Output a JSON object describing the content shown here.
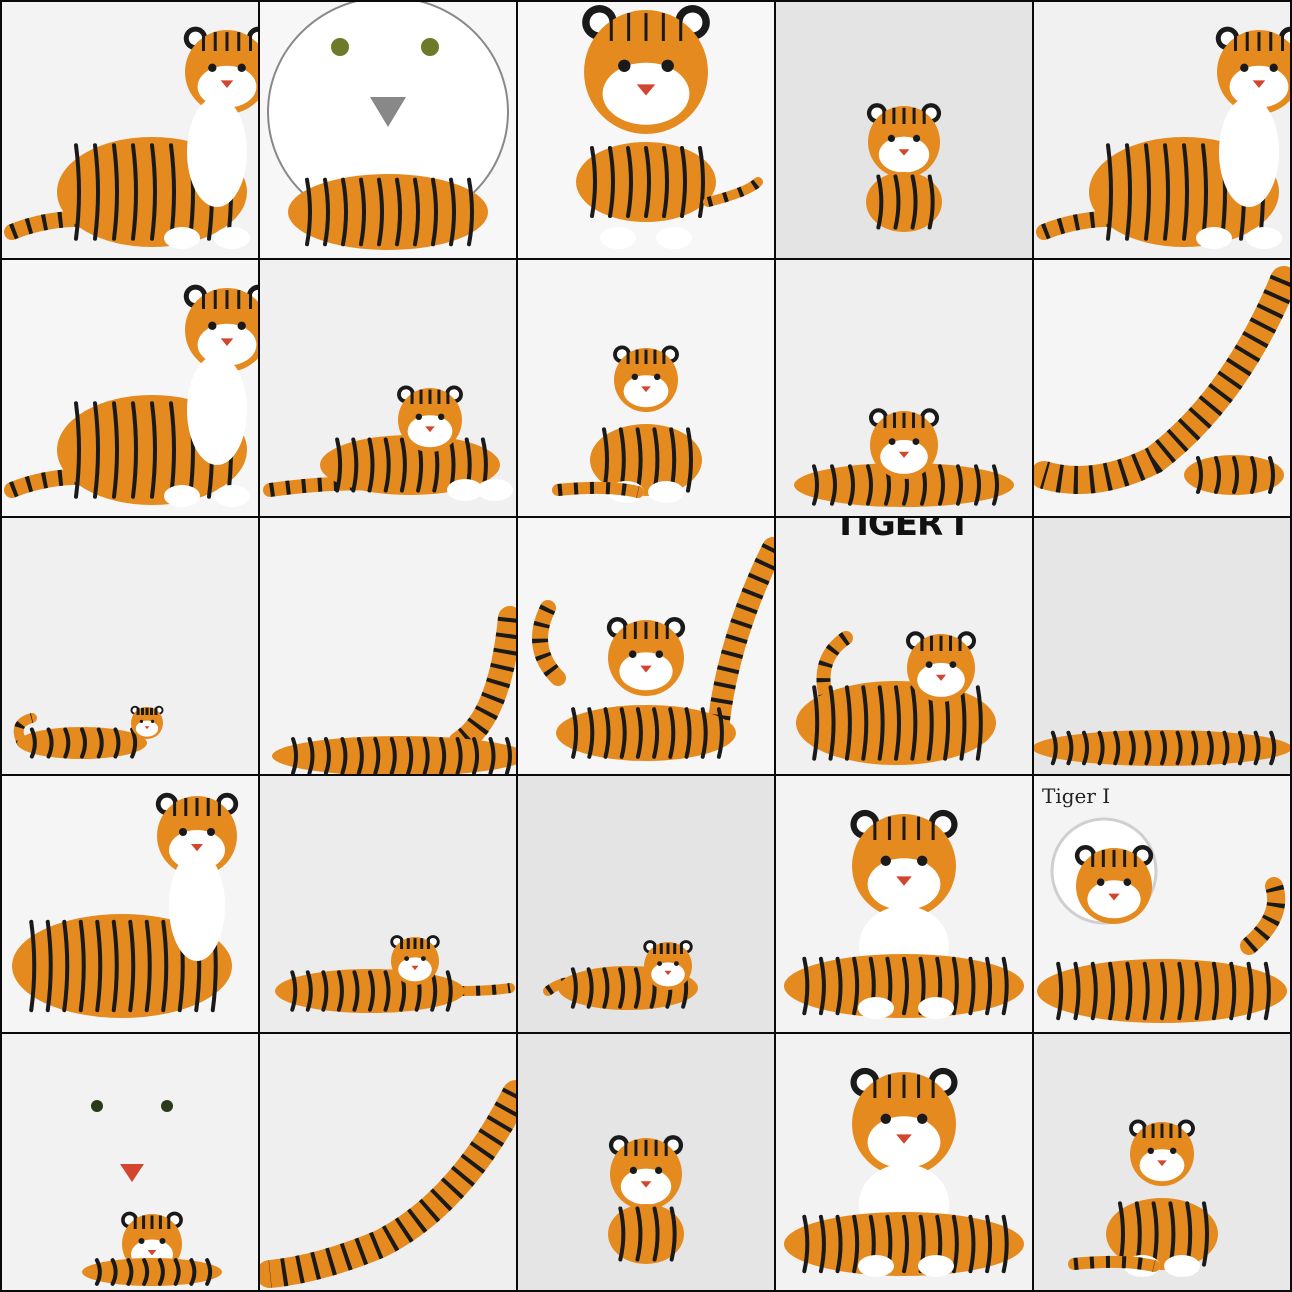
{
  "tiles": [
    {
      "id": "r1c1",
      "pose": "sit-right",
      "bg": "#f3f3f3",
      "caption": ""
    },
    {
      "id": "r1c2",
      "pose": "closeup-white",
      "bg": "#f7f7f7",
      "caption": ""
    },
    {
      "id": "r1c3",
      "pose": "face-front",
      "bg": "#f7f7f7",
      "caption": ""
    },
    {
      "id": "r1c4",
      "pose": "small-sit",
      "bg": "#e4e4e4",
      "caption": ""
    },
    {
      "id": "r1c5",
      "pose": "sit-right",
      "bg": "#f1f1f1",
      "caption": ""
    },
    {
      "id": "r2c1",
      "pose": "sit-right",
      "bg": "#f6f6f6",
      "caption": ""
    },
    {
      "id": "r2c2",
      "pose": "lie",
      "bg": "#f0f0f0",
      "caption": ""
    },
    {
      "id": "r2c3",
      "pose": "sit-front",
      "bg": "#f5f5f5",
      "caption": ""
    },
    {
      "id": "r2c4",
      "pose": "lie-center",
      "bg": "#efefef",
      "caption": ""
    },
    {
      "id": "r2c5",
      "pose": "tail-only",
      "bg": "#f5f5f5",
      "caption": ""
    },
    {
      "id": "r3c1",
      "pose": "small-lie",
      "bg": "#f0f0f0",
      "caption": ""
    },
    {
      "id": "r3c2",
      "pose": "tail-big",
      "bg": "#f3f3f3",
      "caption": ""
    },
    {
      "id": "r3c3",
      "pose": "arch",
      "bg": "#f6f6f6",
      "caption": ""
    },
    {
      "id": "r3c4",
      "pose": "crouch",
      "bg": "#f0f0f0",
      "caption": ""
    },
    {
      "id": "r3c5",
      "pose": "body-strip",
      "bg": "#e6e6e6",
      "caption": ""
    },
    {
      "id": "r4c1",
      "pose": "sit-tall",
      "bg": "#f5f5f5",
      "caption": ""
    },
    {
      "id": "r4c2",
      "pose": "lie-low",
      "bg": "#ececec",
      "caption": ""
    },
    {
      "id": "r4c3",
      "pose": "small-lie2",
      "bg": "#e4e4e4",
      "caption": ""
    },
    {
      "id": "r4c4",
      "pose": "big-sit",
      "bg": "#f3f3f3",
      "caption": ""
    },
    {
      "id": "r4c5",
      "pose": "face-side",
      "bg": "#f4f4f4",
      "caption": ""
    },
    {
      "id": "r5c1",
      "pose": "white-face",
      "bg": "#f2f2f2",
      "caption": ""
    },
    {
      "id": "r5c2",
      "pose": "tail-corner",
      "bg": "#efefef",
      "caption": ""
    },
    {
      "id": "r5c3",
      "pose": "small-sit",
      "bg": "#e5e5e5",
      "caption": ""
    },
    {
      "id": "r5c4",
      "pose": "big-sit",
      "bg": "#f2f2f2",
      "caption": ""
    },
    {
      "id": "r5c5",
      "pose": "sit-front",
      "bg": "#e8e8e8",
      "caption": ""
    }
  ],
  "overlays": {
    "r3c4_text": "TIGER I",
    "r4c5_text": "Tiger I"
  },
  "palette": {
    "orange": "#e58a1e",
    "stripe": "#1a1a1a",
    "white": "#ffffff",
    "nose": "#d2452e"
  }
}
